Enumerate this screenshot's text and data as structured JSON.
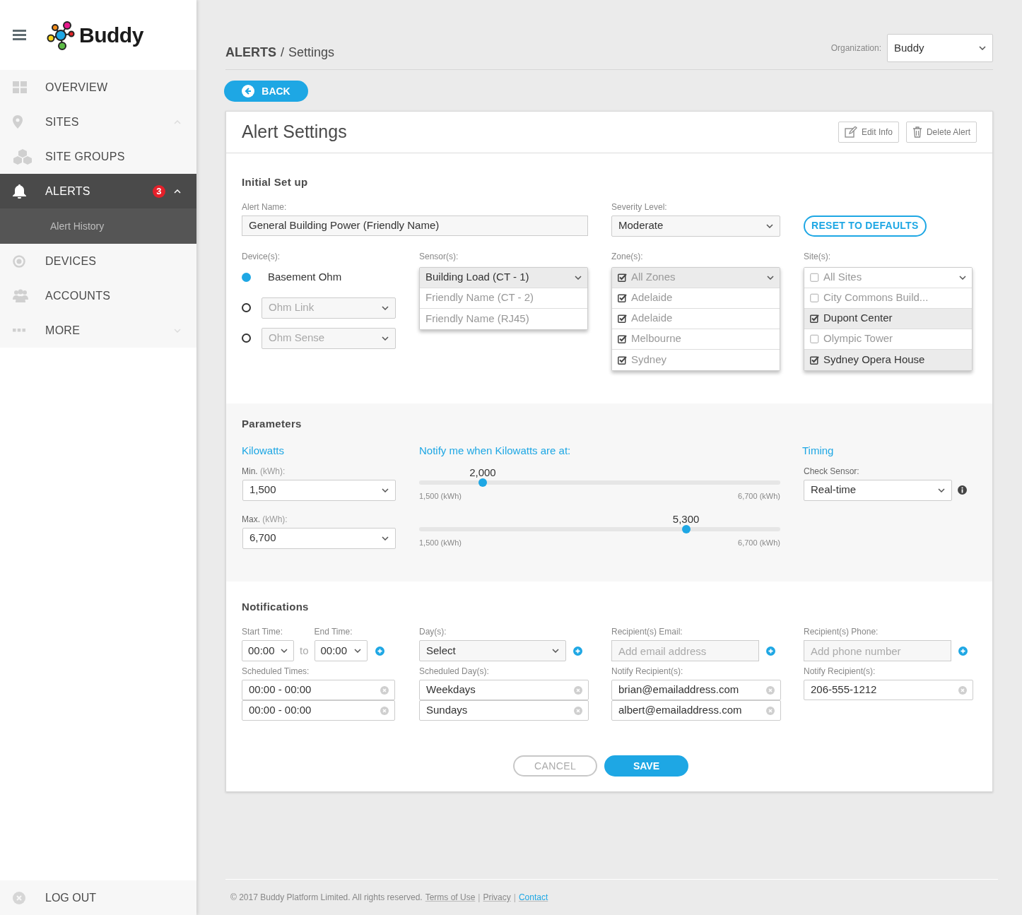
{
  "sidebar": {
    "logo": "Buddy",
    "nav": [
      {
        "label": "OVERVIEW",
        "kind": "grid",
        "selected": false
      },
      {
        "label": "SITES",
        "kind": "pin",
        "selected": false,
        "expanded": true
      },
      {
        "label": "SITE GROUPS",
        "kind": "cubes",
        "selected": false
      },
      {
        "label": "ALERTS",
        "kind": "bell",
        "selected": true,
        "badge": "3",
        "expanded": true,
        "children": [
          {
            "label": "Alert History"
          }
        ]
      },
      {
        "label": "DEVICES",
        "kind": "target",
        "selected": false
      },
      {
        "label": "ACCOUNTS",
        "kind": "people",
        "selected": false
      },
      {
        "label": "MORE",
        "kind": "dots",
        "selected": false,
        "expanded": false
      }
    ],
    "logout": "LOG OUT"
  },
  "header": {
    "breadcrumb": [
      {
        "text": "ALERTS",
        "current": false
      },
      {
        "text": "Settings",
        "current": true
      }
    ],
    "separator": "/",
    "organization": {
      "label": "Organization:",
      "value": "Buddy"
    }
  },
  "back_button": "BACK",
  "card": {
    "title": "Alert Settings",
    "actions": [
      {
        "label": "Edit Info",
        "kind": "edit"
      },
      {
        "label": "Delete Alert",
        "kind": "trash"
      }
    ]
  },
  "initial_setup": {
    "title": "Initial Set up",
    "alert_name": {
      "label": "Alert Name:",
      "value": "General Building Power (Friendly Name)"
    },
    "severity": {
      "label": "Severity Level:",
      "value": "Moderate"
    },
    "reset_button": "RESET TO DEFAULTS",
    "devices": {
      "label": "Device(s):",
      "options": [
        {
          "label": "Basement Ohm",
          "selected": true
        },
        {
          "label": "Ohm Link",
          "selected": false
        },
        {
          "label": "Ohm Sense",
          "selected": false
        }
      ]
    },
    "sensors": {
      "label": "Sensor(s):",
      "kind": "single",
      "options": [
        {
          "label": "Building Load (CT - 1)",
          "selected": true
        },
        {
          "label": "Friendly Name (CT - 2)",
          "selected": false
        },
        {
          "label": "Friendly Name (RJ45)",
          "selected": false
        }
      ]
    },
    "zones": {
      "label": "Zone(s):",
      "kind": "multi",
      "disabled": true,
      "options": [
        {
          "label": "All Zones",
          "checked": true
        },
        {
          "label": "Adelaide",
          "checked": true
        },
        {
          "label": "Adelaide",
          "checked": true
        },
        {
          "label": "Melbourne",
          "checked": true
        },
        {
          "label": "Sydney",
          "checked": true
        }
      ]
    },
    "sites": {
      "label": "Site(s):",
      "kind": "multi",
      "disabled": false,
      "options": [
        {
          "label": "All Sites",
          "checked": false
        },
        {
          "label": "City Commons Build...",
          "checked": false
        },
        {
          "label": "Dupont Center",
          "checked": true
        },
        {
          "label": "Olympic Tower",
          "checked": false
        },
        {
          "label": "Sydney Opera House",
          "checked": true
        }
      ]
    }
  },
  "parameters": {
    "title": "Parameters",
    "kilowatts": {
      "heading": "Kilowatts",
      "fields": [
        {
          "label": "Min.",
          "unit": "(kWh):",
          "value": "1,500"
        },
        {
          "label": "Max.",
          "unit": "(kWh):",
          "value": "6,700"
        }
      ]
    },
    "notify": {
      "heading": "Notify me when Kilowatts are at:",
      "sliders": [
        {
          "reading": "2,000",
          "level": 0.176,
          "min_label": "1,500 (kWh)",
          "max_label": "6,700 (kWh)"
        },
        {
          "reading": "5,300",
          "level": 0.739,
          "min_label": "1,500 (kWh)",
          "max_label": "6,700 (kWh)"
        }
      ]
    },
    "timing": {
      "heading": "Timing",
      "label": "Check Sensor:",
      "value": "Real-time"
    }
  },
  "notifications": {
    "title": "Notifications",
    "time": {
      "start_label": "Start Time:",
      "start": "00:00",
      "to": "to",
      "end_label": "End Time:",
      "end": "00:00",
      "list_label": "Scheduled Times:",
      "items": [
        "00:00 - 00:00",
        "00:00 - 00:00"
      ]
    },
    "days": {
      "label": "Day(s):",
      "value": "Select",
      "list_label": "Scheduled Day(s):",
      "items": [
        "Weekdays",
        "Sundays"
      ]
    },
    "email": {
      "label": "Recipient(s) Email:",
      "placeholder": "Add email address",
      "list_label": "Notify Recipient(s):",
      "items": [
        "brian@emailaddress.com",
        "albert@emailaddress.com"
      ]
    },
    "phone": {
      "label": "Recipient(s) Phone:",
      "placeholder": "Add phone number",
      "list_label": "Notify Recipient(s):",
      "items": [
        "206-555-1212"
      ]
    }
  },
  "form_buttons": {
    "cancel": "CANCEL",
    "save": "SAVE"
  },
  "footer": {
    "text": "© 2017 Buddy Platform Limited. All rights reserved.",
    "links": [
      {
        "label": "Terms of Use",
        "highlighted": false
      },
      {
        "label": "Privacy",
        "highlighted": false
      },
      {
        "label": "Contact",
        "highlighted": true
      }
    ],
    "separators": [
      "|",
      "|"
    ]
  }
}
